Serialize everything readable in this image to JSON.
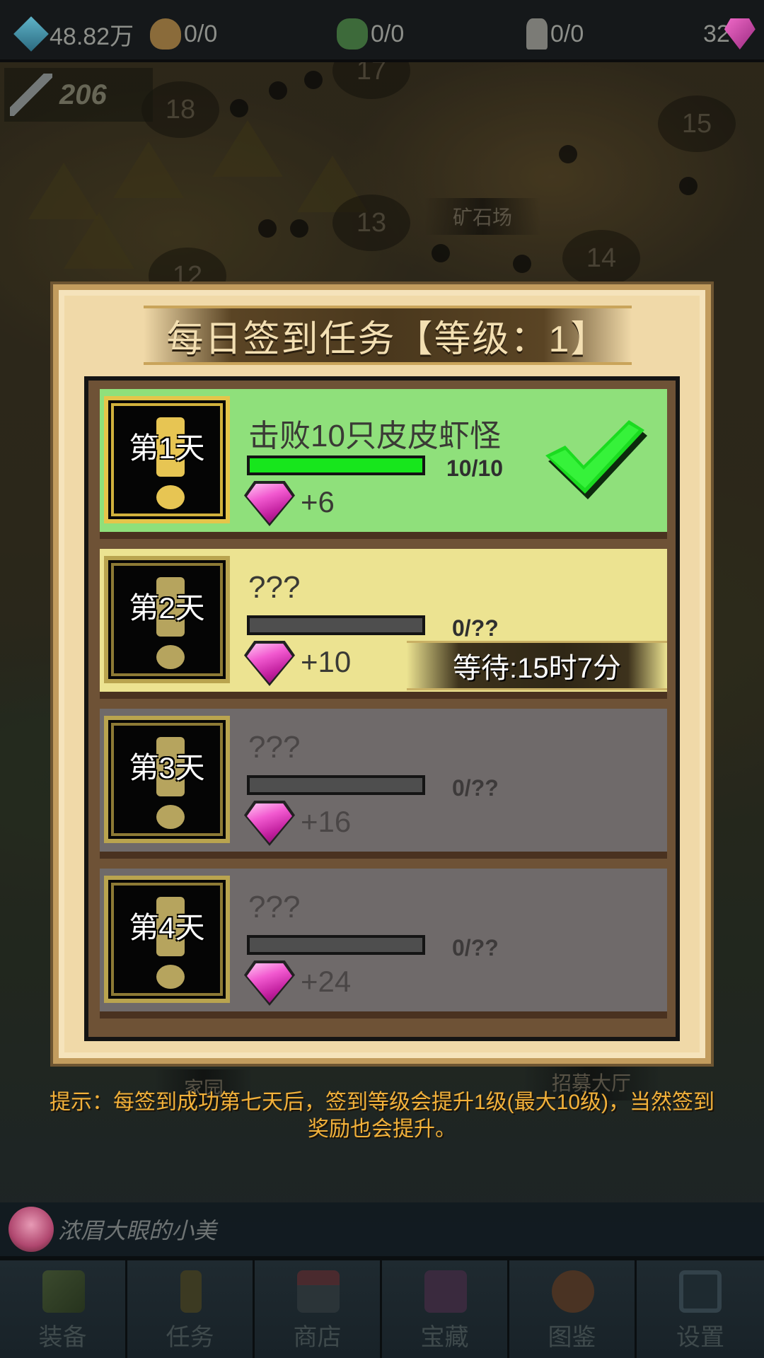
{
  "topbar": {
    "crystal": "48.82万",
    "food": "0/0",
    "wood": "0/0",
    "population": "0/0",
    "gems": "32"
  },
  "power": "206",
  "map": {
    "nodes": [
      "18",
      "15",
      "13",
      "14",
      "12",
      "17"
    ],
    "labels": [
      "矿石场",
      "家园",
      "招募大厅"
    ]
  },
  "dialog": {
    "title": "每日签到任务【等级：1】",
    "tasks": [
      {
        "day": "第1天",
        "name": "击败10只皮皮虾怪",
        "progress": "10/10",
        "progress_fraction": 1.0,
        "reward": "+6",
        "state": "done"
      },
      {
        "day": "第2天",
        "name": "???",
        "progress": "0/??",
        "progress_fraction": 0,
        "reward": "+10",
        "state": "waiting",
        "wait": "等待:15时7分"
      },
      {
        "day": "第3天",
        "name": "???",
        "progress": "0/??",
        "progress_fraction": 0,
        "reward": "+16",
        "state": "locked"
      },
      {
        "day": "第4天",
        "name": "???",
        "progress": "0/??",
        "progress_fraction": 0,
        "reward": "+24",
        "state": "locked"
      }
    ]
  },
  "hint": "提示：每签到成功第七天后，签到等级会提升1级(最大10级)，当然签到奖励也会提升。",
  "chat": {
    "name": "浓眉大眼的小美"
  },
  "nav": [
    "装备",
    "任务",
    "商店",
    "宝藏",
    "图鉴",
    "设置"
  ],
  "colors": {
    "done": "#8fe07b",
    "waiting": "#ece391",
    "locked": "#6f6a6a",
    "hint": "#f2b13a",
    "progress_fill": "#17e61c"
  }
}
